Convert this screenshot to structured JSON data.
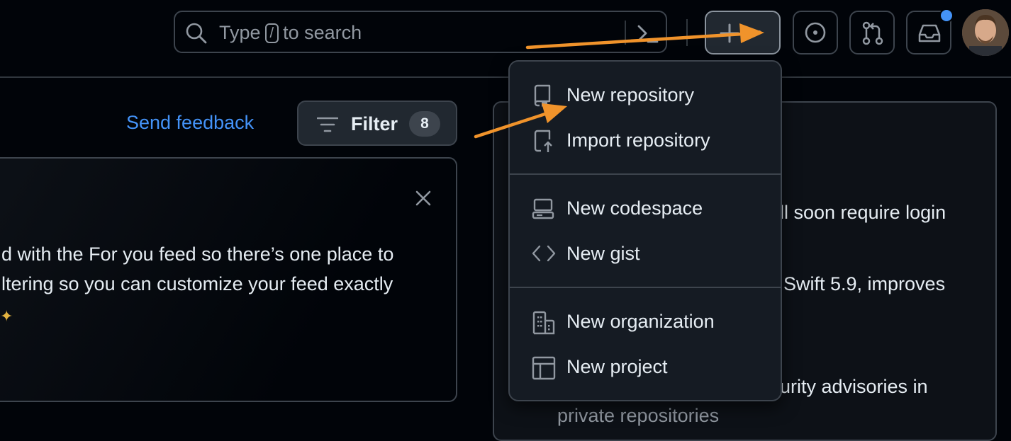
{
  "header": {
    "search": {
      "placeholder_prefix": "Type",
      "shortcut_key": "/",
      "placeholder_suffix": "to search"
    },
    "create_button_label": "+",
    "notification_dot_color": "#4493f8"
  },
  "feed": {
    "send_feedback_label": "Send feedback",
    "filter": {
      "label": "Filter",
      "count": "8"
    },
    "announcement": {
      "line1": "d with the For you feed so there’s one place to",
      "line2": "ltering so you can customize your feed exactly"
    }
  },
  "right_panel": {
    "line1": "ll soon require login",
    "line2": "Swift 5.9, improves",
    "line3": "urity advisories in",
    "line4": "private repositories"
  },
  "create_menu": {
    "items": [
      {
        "label": "New repository",
        "icon": "repo-icon"
      },
      {
        "label": "Import repository",
        "icon": "repo-push-icon"
      },
      {
        "label": "New codespace",
        "icon": "codespaces-icon"
      },
      {
        "label": "New gist",
        "icon": "code-icon"
      },
      {
        "label": "New organization",
        "icon": "organization-icon"
      },
      {
        "label": "New project",
        "icon": "table-icon"
      }
    ]
  },
  "annotation_color": "#f0932b"
}
